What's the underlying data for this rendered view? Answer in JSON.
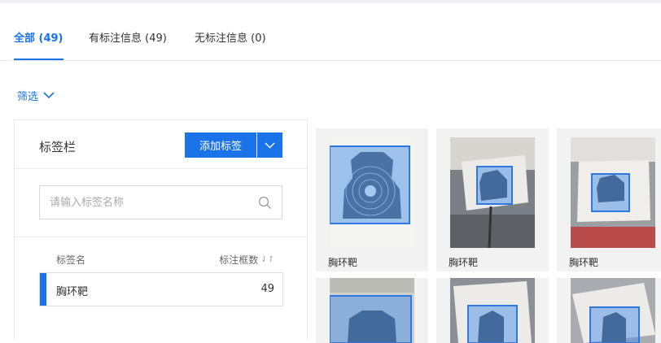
{
  "tabs": [
    {
      "label": "全部 (49)",
      "active": true
    },
    {
      "label": "有标注信息 (49)",
      "active": false
    },
    {
      "label": "无标注信息 (0)",
      "active": false
    }
  ],
  "filter": {
    "label": "筛选"
  },
  "label_panel": {
    "title": "标签栏",
    "add_button": "添加标签",
    "search_placeholder": "请输入标签名称",
    "columns": {
      "name": "标签名",
      "count": "标注框数"
    },
    "rows": [
      {
        "name": "胸环靶",
        "count": "49"
      }
    ]
  },
  "gallery": {
    "items": [
      {
        "caption": "胸环靶"
      },
      {
        "caption": "胸环靶"
      },
      {
        "caption": "胸环靶"
      },
      {
        "caption": ""
      },
      {
        "caption": ""
      },
      {
        "caption": ""
      }
    ]
  },
  "colors": {
    "accent": "#1a73e8",
    "card_bg": "#f2f2f2",
    "bbox_fill": "#4a8fe7"
  },
  "icons": [
    "chevron-down-icon",
    "search-icon",
    "sort-icon"
  ]
}
